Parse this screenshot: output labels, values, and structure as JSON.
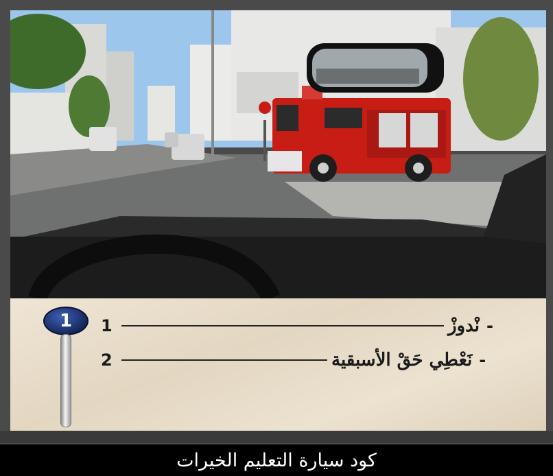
{
  "question": {
    "number": "1"
  },
  "answers": [
    {
      "number": "1",
      "text": "نْدوزْ"
    },
    {
      "number": "2",
      "text": "نَعْطِي حَقْ الأسبقية"
    }
  ],
  "caption": "كود سيارة التعليم الخيرات",
  "scene": {
    "description_icon": "driving-scene-fire-truck",
    "colors": {
      "sky": "#9cc6ec",
      "truck": "#c81d14",
      "road": "#6f7070",
      "dashboard": "#1c1c1c"
    }
  }
}
